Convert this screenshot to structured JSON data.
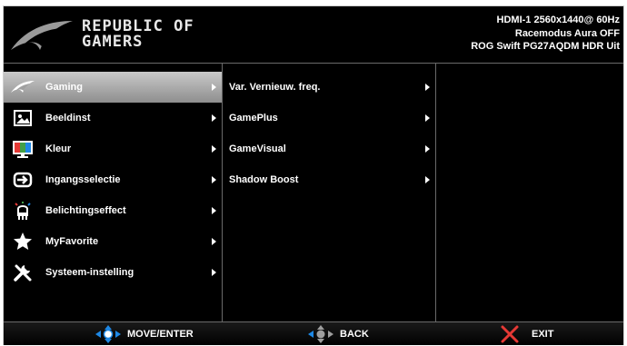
{
  "brand": {
    "line1": "REPUBLIC OF",
    "line2": "GAMERS"
  },
  "status": {
    "line1": "HDMI-1  2560x1440@  60Hz",
    "line2": "Racemodus   Aura OFF",
    "line3": "ROG Swift   PG27AQDM   HDR Uit"
  },
  "main_menu": [
    {
      "label": "Gaming",
      "icon": "rog-eye-icon",
      "active": true
    },
    {
      "label": "Beeldinst",
      "icon": "image-icon"
    },
    {
      "label": "Kleur",
      "icon": "color-icon"
    },
    {
      "label": "Ingangsselectie",
      "icon": "input-icon"
    },
    {
      "label": "Belichtingseffect",
      "icon": "lighting-icon"
    },
    {
      "label": "MyFavorite",
      "icon": "star-icon"
    },
    {
      "label": "Systeem-instelling",
      "icon": "wrench-icon"
    }
  ],
  "sub_menu": [
    {
      "label": "Var. Vernieuw. freq."
    },
    {
      "label": "GamePlus"
    },
    {
      "label": "GameVisual"
    },
    {
      "label": "Shadow Boost"
    }
  ],
  "footer": {
    "move_enter": "MOVE/ENTER",
    "back": "BACK",
    "exit": "EXIT"
  },
  "colors": {
    "accent": "#1e88e5",
    "exit": "#d32f2f",
    "highlight": "#b0b0b0"
  }
}
